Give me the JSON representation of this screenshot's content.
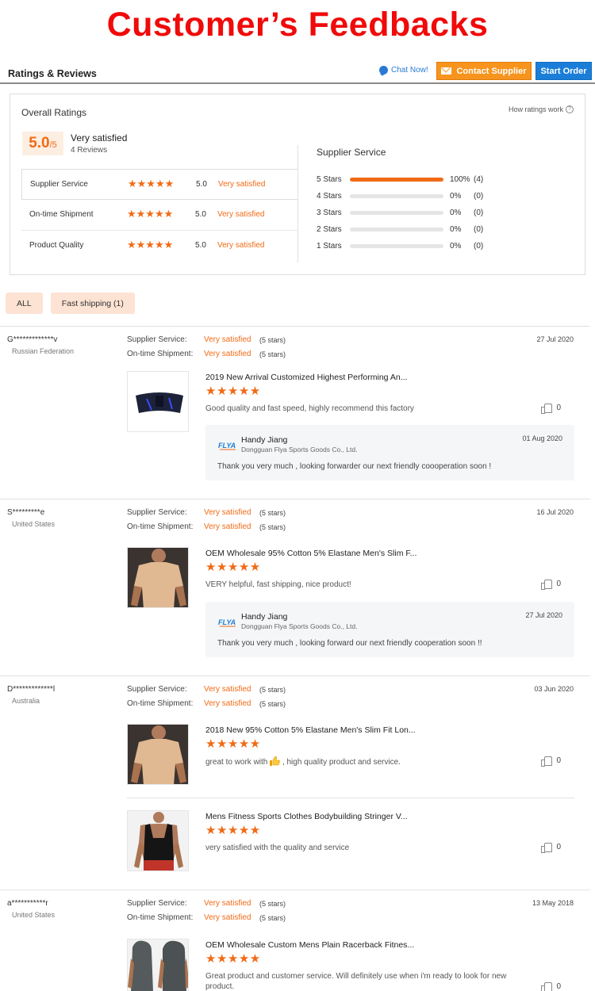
{
  "banner": {
    "title": "Customer’s Feedbacks"
  },
  "header": {
    "title": "Ratings & Reviews",
    "chat_label": "Chat Now!",
    "contact_label": "Contact Supplier",
    "start_label": "Start Order"
  },
  "overall": {
    "title": "Overall Ratings",
    "how_label": "How ratings work",
    "score": "5.0",
    "score_suffix": "/5",
    "verdict": "Very satisfied",
    "review_count": "4 Reviews",
    "metrics": [
      {
        "label": "Supplier Service",
        "value": "5.0",
        "text": "Very satisfied",
        "stars": 5
      },
      {
        "label": "On-time Shipment",
        "value": "5.0",
        "text": "Very satisfied",
        "stars": 5
      },
      {
        "label": "Product Quality",
        "value": "5.0",
        "text": "Very satisfied",
        "stars": 5
      }
    ],
    "distribution_title": "Supplier Service",
    "distribution": [
      {
        "label": "5 Stars",
        "pct": "100%",
        "count": "(4)",
        "fill": 1.0
      },
      {
        "label": "4 Stars",
        "pct": "0%",
        "count": "(0)",
        "fill": 0
      },
      {
        "label": "3 Stars",
        "pct": "0%",
        "count": "(0)",
        "fill": 0
      },
      {
        "label": "2 Stars",
        "pct": "0%",
        "count": "(0)",
        "fill": 0
      },
      {
        "label": "1 Stars",
        "pct": "0%",
        "count": "(0)",
        "fill": 0
      }
    ]
  },
  "filters": [
    "ALL",
    "Fast shipping (1)"
  ],
  "review_labels": {
    "supplier_service": "Supplier Service:",
    "ontime_shipment": "On-time Shipment:"
  },
  "reviews": [
    {
      "user": "G*************v",
      "country": "Russian Federation",
      "supplier_rating": "Very satisfied",
      "supplier_stars": "(5 stars)",
      "shipment_rating": "Very satisfied",
      "shipment_stars": "(5 stars)",
      "date": "27 Jul 2020",
      "products": [
        {
          "name": "2019 New Arrival Customized Highest Performing An...",
          "stars": 5,
          "comment": "Good quality and fast speed, highly recommend this factory",
          "likes": "0",
          "thumb": "belt"
        }
      ],
      "reply": {
        "name": "Handy Jiang",
        "company": "Dongguan Flya Sports Goods Co., Ltd.",
        "date": "01 Aug 2020",
        "text": "Thank you very much , looking forwarder our next friendly coooperation soon !"
      }
    },
    {
      "user": "S*********e",
      "country": "United States",
      "supplier_rating": "Very satisfied",
      "supplier_stars": "(5 stars)",
      "shipment_rating": "Very satisfied",
      "shipment_stars": "(5 stars)",
      "date": "16 Jul 2020",
      "products": [
        {
          "name": "OEM Wholesale 95% Cotton 5% Elastane Men's Slim F...",
          "stars": 5,
          "comment": "VERY helpful, fast shipping, nice product!",
          "likes": "0",
          "thumb": "tshirt"
        }
      ],
      "reply": {
        "name": "Handy Jiang",
        "company": "Dongguan Flya Sports Goods Co., Ltd.",
        "date": "27 Jul 2020",
        "text": "Thank you very much , looking forward our next friendly cooperation soon !!"
      }
    },
    {
      "user": "D*************l",
      "country": "Australia",
      "supplier_rating": "Very satisfied",
      "supplier_stars": "(5 stars)",
      "shipment_rating": "Very satisfied",
      "shipment_stars": "(5 stars)",
      "date": "03 Jun 2020",
      "products": [
        {
          "name": "2018 New 95% Cotton 5% Elastane Men's Slim Fit Lon...",
          "stars": 5,
          "comment_before": "great to work with",
          "comment_after": ", high quality product and service.",
          "comment_icon": "thumbs-up-emoji-icon",
          "likes": "0",
          "thumb": "tshirt"
        },
        {
          "name": "Mens Fitness Sports Clothes Bodybuilding Stringer V...",
          "stars": 5,
          "comment": "very satisfied with the quality and service",
          "likes": "0",
          "thumb": "tank"
        }
      ]
    },
    {
      "user": "a***********r",
      "country": "United States",
      "supplier_rating": "Very satisfied",
      "supplier_stars": "(5 stars)",
      "shipment_rating": "Very satisfied",
      "shipment_stars": "(5 stars)",
      "date": "13 May 2018",
      "products": [
        {
          "name": "OEM Wholesale Custom Mens Plain Racerback Fitnes...",
          "stars": 5,
          "comment": "Great product and customer service.  Will definitely use when i'm ready to look for new product.",
          "likes": "0",
          "thumb": "hoodie"
        }
      ]
    }
  ],
  "colors": {
    "accent": "#f16a15",
    "banner": "#f00a0a",
    "contact": "#f7941d",
    "start": "#1a7ed8"
  },
  "supplier_logo_text": "FLYA"
}
